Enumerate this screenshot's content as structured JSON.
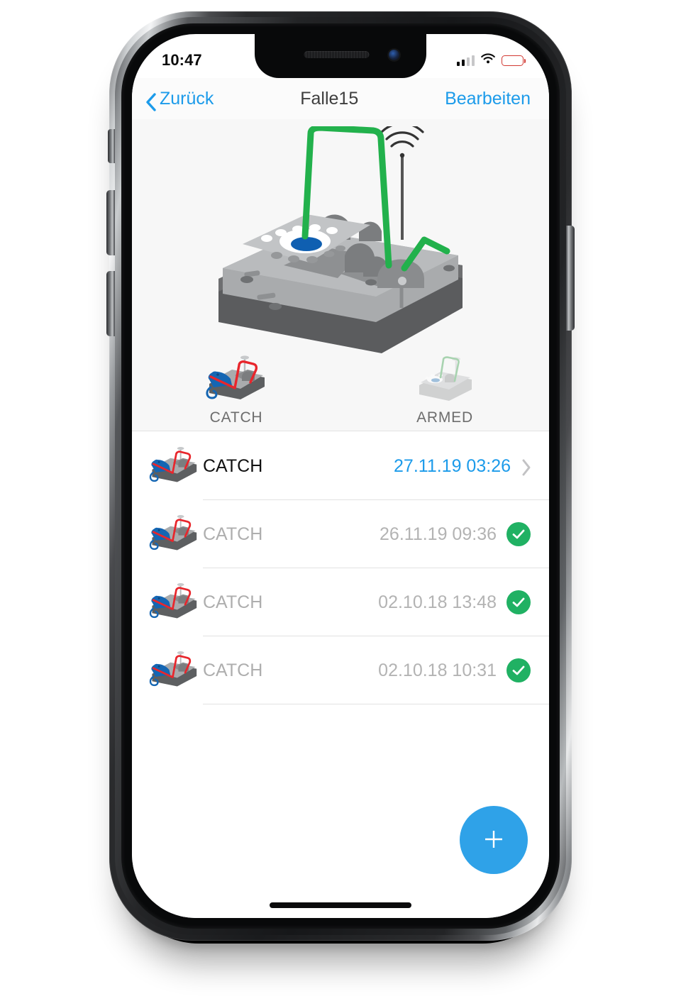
{
  "device": {
    "status_bar": {
      "time": "10:47",
      "cellular_icon": "cellular-signal-icon",
      "wifi_icon": "wifi-icon",
      "battery_icon": "battery-low-icon",
      "battery_level_percent": 15,
      "battery_color": "#ec3b33"
    },
    "home_indicator": "home-indicator"
  },
  "nav": {
    "back_label": "Zurück",
    "back_icon": "chevron-left-icon",
    "title": "Falle15",
    "edit_label": "Bearbeiten",
    "accent_color": "#1c9bea"
  },
  "hero": {
    "device_illustration": "smart-mousetrap-illustration",
    "wifi_antenna_icon": "wifi-antenna-icon",
    "statuses": [
      {
        "icon": "trap-catch-icon",
        "label": "CATCH",
        "state": "active"
      },
      {
        "icon": "trap-armed-icon",
        "label": "ARMED",
        "state": "inactive"
      }
    ]
  },
  "list": {
    "rows": [
      {
        "icon": "trap-catch-icon",
        "label": "CATCH",
        "date": "27.11.19 03:26",
        "trailing": "chevron-right-icon",
        "unread": true
      },
      {
        "icon": "trap-catch-icon",
        "label": "CATCH",
        "date": "26.11.19 09:36",
        "trailing": "check-circle-icon",
        "unread": false
      },
      {
        "icon": "trap-catch-icon",
        "label": "CATCH",
        "date": "02.10.18 13:48",
        "trailing": "check-circle-icon",
        "unread": false
      },
      {
        "icon": "trap-catch-icon",
        "label": "CATCH",
        "date": "02.10.18 10:31",
        "trailing": "check-circle-icon",
        "unread": false
      }
    ],
    "check_color": "#20b163"
  },
  "fab": {
    "icon": "plus-icon",
    "label": "+",
    "color": "#2fa2e8"
  }
}
